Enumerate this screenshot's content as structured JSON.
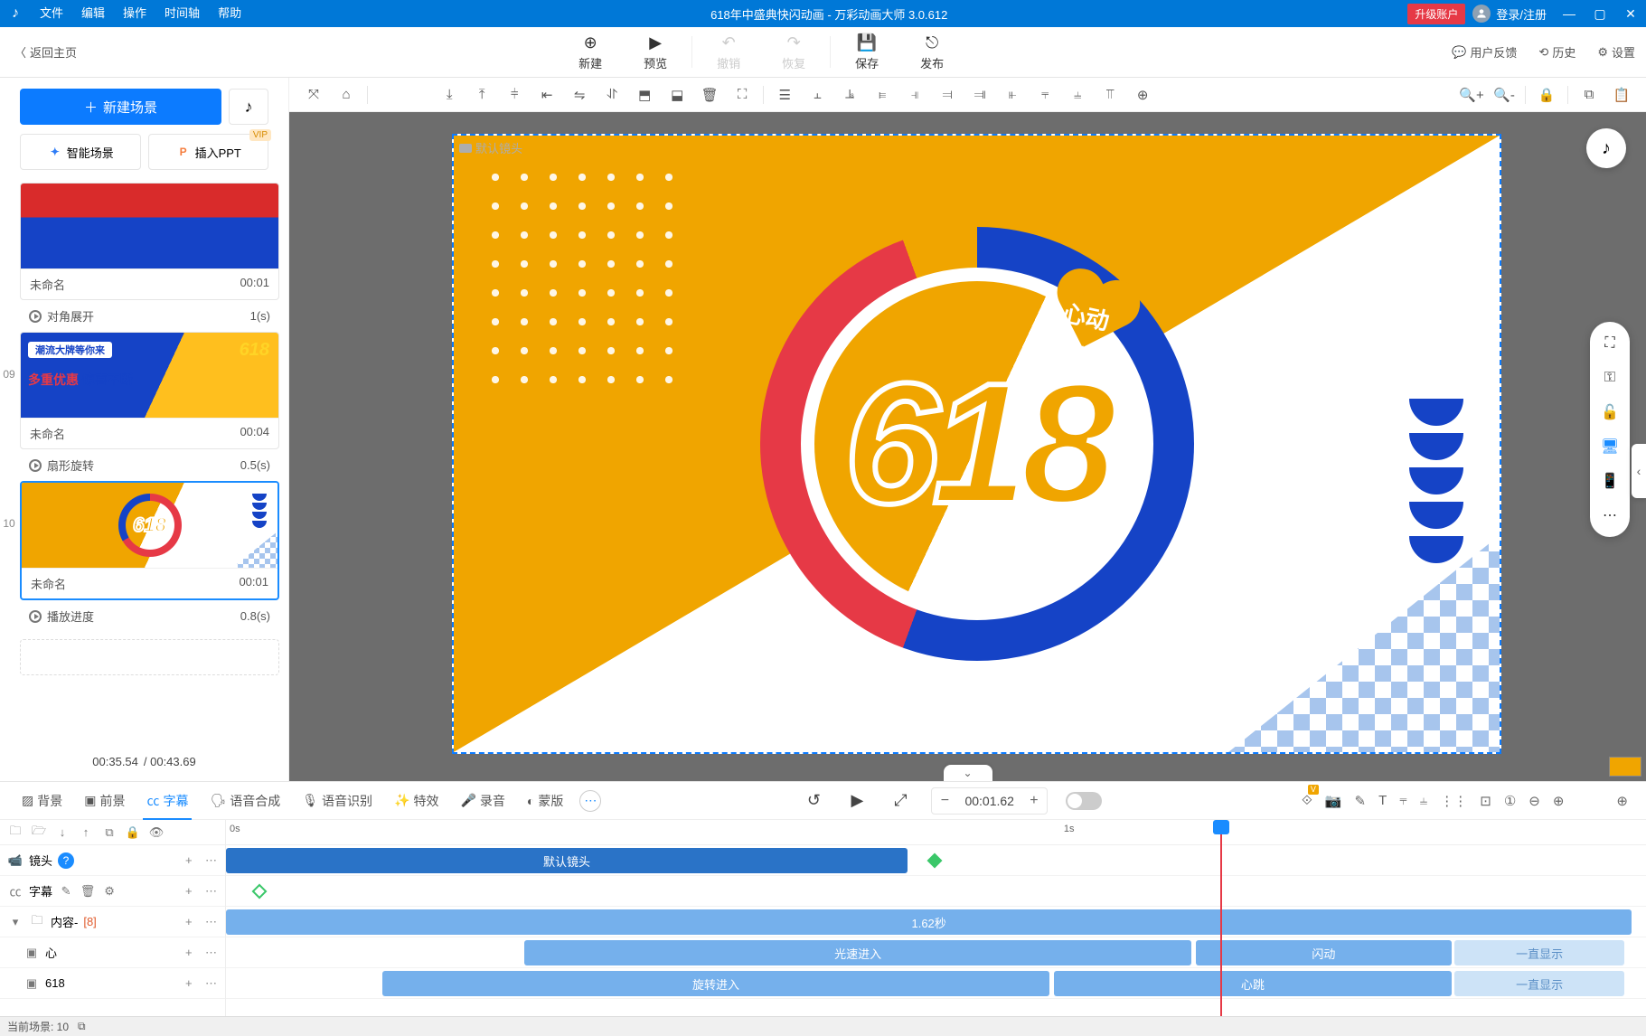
{
  "menu": {
    "file": "文件",
    "edit": "编辑",
    "operate": "操作",
    "timeline": "时间轴",
    "help": "帮助"
  },
  "title": "618年中盛典快闪动画 - 万彩动画大师 3.0.612",
  "title_bar": {
    "upgrade": "升级账户",
    "login": "登录/注册"
  },
  "top": {
    "back": "返回主页",
    "new": "新建",
    "preview": "预览",
    "undo": "撤销",
    "redo": "恢复",
    "save": "保存",
    "publish": "发布",
    "feedback": "用户反馈",
    "history": "历史",
    "settings": "设置"
  },
  "scenes": {
    "new_btn": "新建场景",
    "ai_scene": "智能场景",
    "insert_ppt": "插入PPT",
    "items": [
      {
        "idx": "",
        "name": "未命名",
        "time": "00:01",
        "trans_name": "对角展开",
        "trans_dur": "1(s)"
      },
      {
        "idx": "09",
        "name": "未命名",
        "time": "00:04",
        "trans_name": "扇形旋转",
        "trans_dur": "0.5(s)"
      },
      {
        "idx": "10",
        "name": "未命名",
        "time": "00:01",
        "trans_name": "播放进度",
        "trans_dur": "0.8(s)"
      }
    ],
    "cur": "00:35.54",
    "total": "/ 00:43.69"
  },
  "canvas": {
    "default_cam": "默认镜头",
    "big_text": "618",
    "heart_text": "心动"
  },
  "panel": {
    "tabs": [
      "背景",
      "前景",
      "字幕",
      "语音合成",
      "语音识别",
      "特效",
      "录音",
      "蒙版"
    ],
    "active": 2,
    "time": "00:01.62",
    "ruler": [
      "0s",
      "1s"
    ]
  },
  "tracks": {
    "cam": "镜头",
    "subtitle": "字幕",
    "content": "内容-",
    "content_count": "[8]",
    "heart": "心",
    "num": "618",
    "default_cam_clip": "默认镜头",
    "dur_clip": "1.62秒",
    "light_enter": "光速进入",
    "flash": "闪动",
    "always1": "一直显示",
    "rotate_enter": "旋转进入",
    "heartbeat": "心跳",
    "always2": "一直显示"
  },
  "status": {
    "scene": "当前场景: 10"
  }
}
